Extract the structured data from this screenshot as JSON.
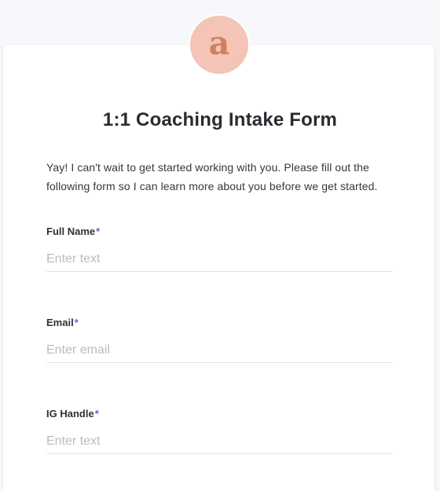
{
  "brand": {
    "avatar_letter": "a",
    "avatar_bg": "#f4c4b6",
    "avatar_fg": "#cf7f5f"
  },
  "form": {
    "title": "1:1 Coaching Intake Form",
    "intro": "Yay! I can't wait to get started working with you. Please fill out the following form so I can learn more about you before we get started.",
    "required_marker": "*",
    "required_color": "#7059d9",
    "fields": [
      {
        "label": "Full Name",
        "placeholder": "Enter text",
        "value": "",
        "required": true
      },
      {
        "label": "Email",
        "placeholder": "Enter email",
        "value": "",
        "required": true
      },
      {
        "label": "IG Handle",
        "placeholder": "Enter text",
        "value": "",
        "required": true
      }
    ]
  }
}
